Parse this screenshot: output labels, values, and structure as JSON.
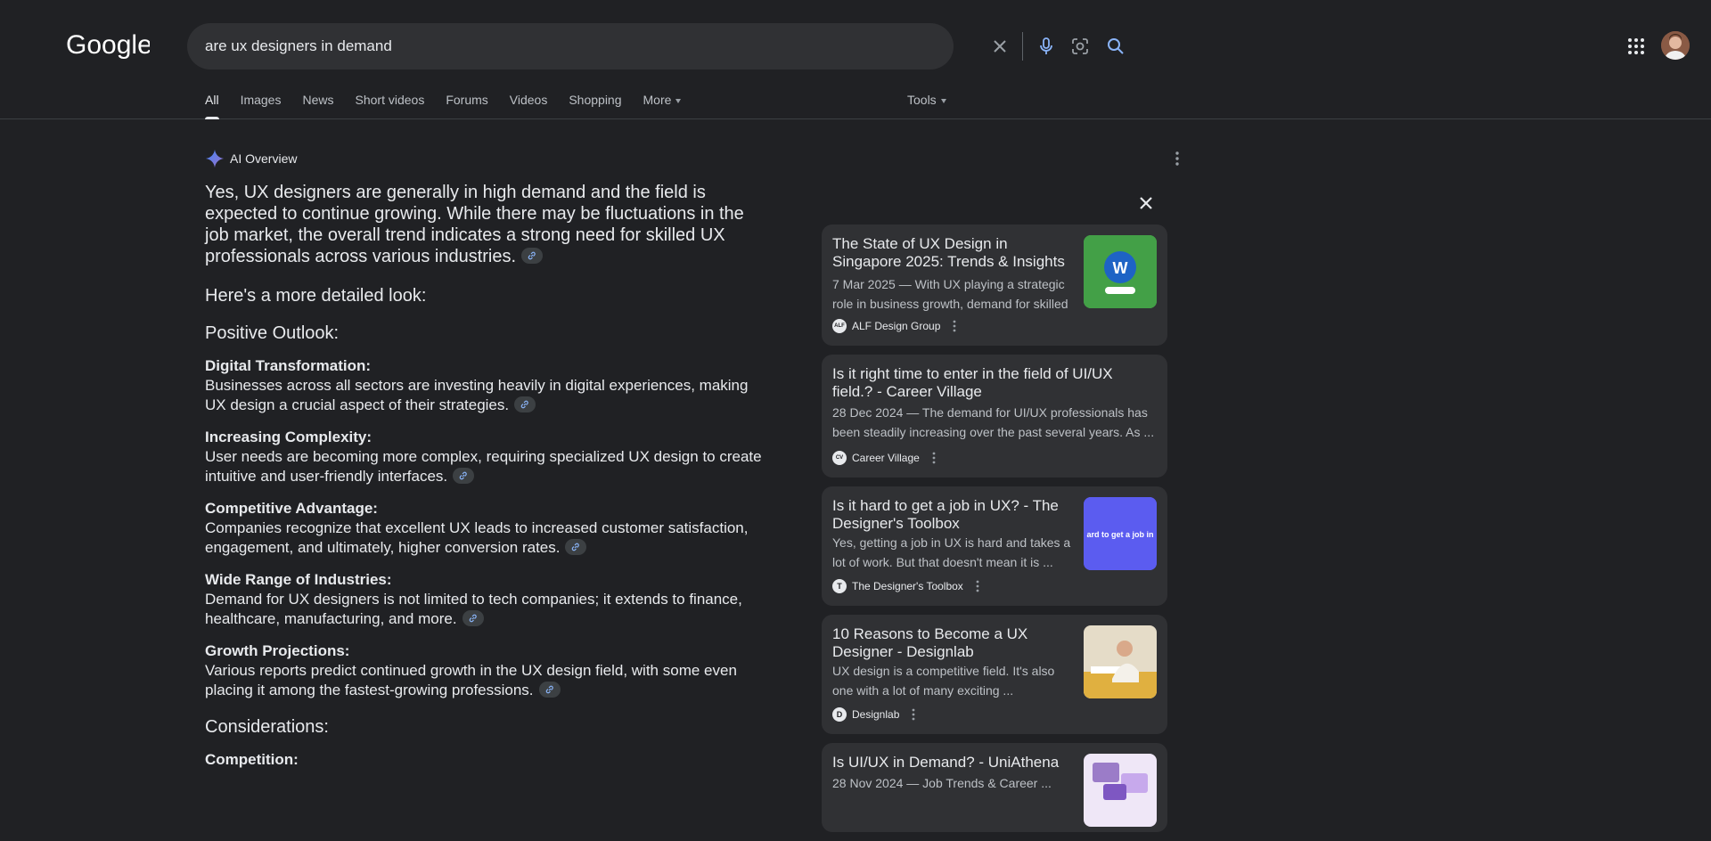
{
  "search": {
    "query": "are ux designers in demand",
    "logo_text": "Google"
  },
  "tabs": [
    {
      "label": "All",
      "active": true
    },
    {
      "label": "Images"
    },
    {
      "label": "News"
    },
    {
      "label": "Short videos"
    },
    {
      "label": "Forums"
    },
    {
      "label": "Videos"
    },
    {
      "label": "Shopping"
    },
    {
      "label": "More"
    }
  ],
  "tools_label": "Tools",
  "ai_overview": {
    "label": "AI Overview",
    "lead": "Yes, UX designers are generally in high demand and the field is expected to continue growing. While there may be fluctuations in the job market, the overall trend indicates a strong need for skilled UX professionals across various industries.",
    "detail_heading": "Here's a more detailed look:",
    "section1": "Positive Outlook:",
    "items": [
      {
        "title": "Digital Transformation:",
        "body": "Businesses across all sectors are investing heavily in digital experiences, making UX design a crucial aspect of their strategies."
      },
      {
        "title": "Increasing Complexity:",
        "body": "User needs are becoming more complex, requiring specialized UX design to create intuitive and user-friendly interfaces."
      },
      {
        "title": "Competitive Advantage:",
        "body": "Companies recognize that excellent UX leads to increased customer satisfaction, engagement, and ultimately, higher conversion rates."
      },
      {
        "title": "Wide Range of Industries:",
        "body": "Demand for UX designers is not limited to tech companies; it extends to finance, healthcare, manufacturing, and more."
      },
      {
        "title": "Growth Projections:",
        "body": "Various reports predict continued growth in the UX design field, with some even placing it among the fastest-growing professions."
      }
    ],
    "section2": "Considerations:",
    "section2_item": "Competition:"
  },
  "sources": [
    {
      "title": "The State of UX Design in Singapore 2025: Trends & Insights",
      "snippet": "7 Mar 2025 — With UX playing a strategic role in business growth, demand for skilled ...",
      "site": "ALF Design Group",
      "favicon": "ALF",
      "thumb_color": "#4caf50"
    },
    {
      "title": "Is it right time to enter in the field of UI/UX field.? - Career Village",
      "snippet": "28 Dec 2024 — The demand for UI/UX professionals has been steadily increasing over the past several years. As ...",
      "site": "Career Village",
      "favicon": "CV",
      "thumb_color": ""
    },
    {
      "title": "Is it hard to get a job in UX? - The Designer's Toolbox",
      "snippet": "Yes, getting a job in UX is hard and takes a lot of work. But that doesn't mean it is ...",
      "site": "The Designer's Toolbox",
      "favicon": "T",
      "thumb_color": "#5b5cf0",
      "thumb_text": "ard to get a job in"
    },
    {
      "title": "10 Reasons to Become a UX Designer - Designlab",
      "snippet": "UX design is a competitive field. It's also one with a lot of many exciting ...",
      "site": "Designlab",
      "favicon": "D",
      "thumb_color": "#e0b040"
    },
    {
      "title": "Is UI/UX in Demand? - UniAthena",
      "snippet": "28 Nov 2024 — Job Trends & Career ...",
      "site": "UniAthena",
      "favicon": "U",
      "thumb_color": "#9b7cc8"
    }
  ]
}
